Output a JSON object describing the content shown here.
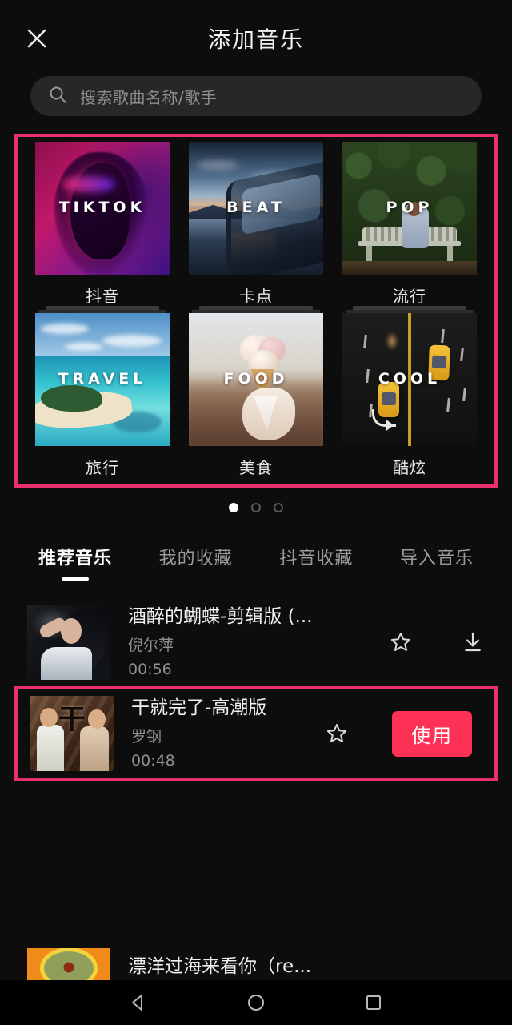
{
  "header": {
    "title": "添加音乐",
    "close_icon": "close-icon"
  },
  "search": {
    "placeholder": "搜索歌曲名称/歌手",
    "icon": "search-icon"
  },
  "categories": {
    "items": [
      {
        "overlay": "TIKTOK",
        "label": "抖音"
      },
      {
        "overlay": "BEAT",
        "label": "卡点"
      },
      {
        "overlay": "POP",
        "label": "流行"
      },
      {
        "overlay": "TRAVEL",
        "label": "旅行"
      },
      {
        "overlay": "FOOD",
        "label": "美食"
      },
      {
        "overlay": "COOL",
        "label": "酷炫"
      }
    ],
    "highlight_color": "#e8306f"
  },
  "pager": {
    "total": 3,
    "active_index": 0
  },
  "tabs": [
    {
      "label": "推荐音乐",
      "active": true
    },
    {
      "label": "我的收藏",
      "active": false
    },
    {
      "label": "抖音收藏",
      "active": false
    },
    {
      "label": "导入音乐",
      "active": false
    }
  ],
  "songs": [
    {
      "title": "酒醉的蝴蝶-剪辑版 (...",
      "artist": "倪尔萍",
      "duration": "00:56",
      "favorite_icon": "star-icon",
      "download_icon": "download-icon",
      "selected": false
    },
    {
      "title": "干就完了-高潮版",
      "artist": "罗钢",
      "duration": "00:48",
      "favorite_icon": "star-icon",
      "use_label": "使用",
      "selected": true,
      "use_button_color": "#fd3055"
    },
    {
      "title": "漂洋过海来看你（re...",
      "artist": "",
      "duration": "",
      "selected": false
    }
  ],
  "song_art": {
    "third_glyph": "干"
  },
  "navbar": {
    "back": "back-triangle-icon",
    "home": "home-circle-icon",
    "recents": "recents-square-icon"
  }
}
